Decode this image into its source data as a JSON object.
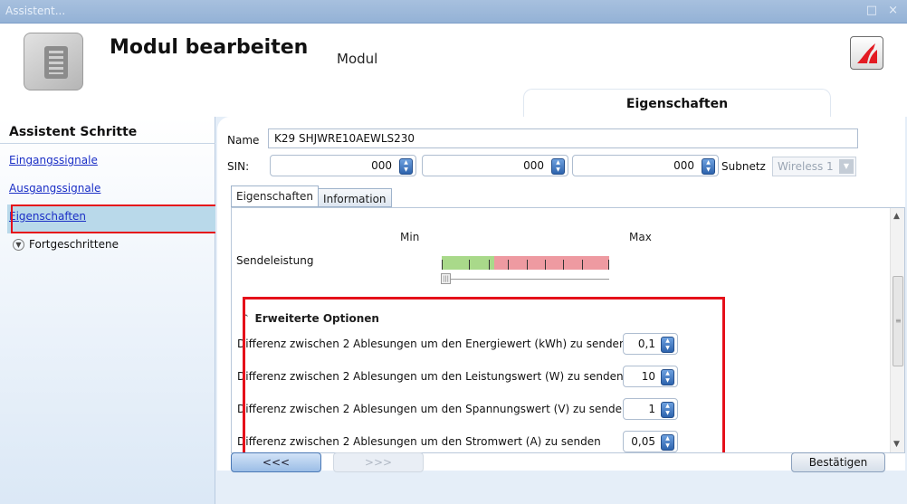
{
  "window": {
    "title": "Assistent...",
    "controls": "□ ×"
  },
  "header": {
    "title": "Modul bearbeiten",
    "subtitle": "Modul",
    "section_tab": "Eigenschaften"
  },
  "sidebar": {
    "title": "Assistent Schritte",
    "items": [
      {
        "label": "Eingangssignale"
      },
      {
        "label": "Ausgangssignale"
      },
      {
        "label": "Eigenschaften"
      }
    ],
    "expander_label": "Fortgeschrittene"
  },
  "form": {
    "name_label": "Name",
    "name_value": "K29 SHJWRE10AEWLS230",
    "sin_label": "SIN:",
    "sin_values": [
      "000",
      "000",
      "000"
    ],
    "subnet_label": "Subnetz",
    "subnet_value": "Wireless 1"
  },
  "tabs": [
    {
      "label": "Eigenschaften"
    },
    {
      "label": "Information"
    }
  ],
  "properties": {
    "min_label": "Min",
    "max_label": "Max",
    "transmit_power_label": "Sendeleistung"
  },
  "advanced": {
    "title": "Erweiterte Optionen",
    "rows": [
      {
        "label": "Differenz zwischen 2 Ablesungen um den Energiewert (kWh) zu senden",
        "value": "0,1"
      },
      {
        "label": "Differenz zwischen 2 Ablesungen um den Leistungswert (W) zu senden",
        "value": "10"
      },
      {
        "label": "Differenz zwischen 2 Ablesungen um den Spannungswert (V) zu senden",
        "value": "1"
      },
      {
        "label": "Differenz zwischen 2 Ablesungen um den Stromwert (A) zu senden",
        "value": "0,05"
      }
    ]
  },
  "buttons": {
    "prev_label": "<<<",
    "next_label": ">>>",
    "confirm_label": "Bestätigen"
  },
  "colors": {
    "highlight_red": "#e5101a",
    "titlebar": "#a7c0de",
    "link": "#1b2fc6"
  }
}
